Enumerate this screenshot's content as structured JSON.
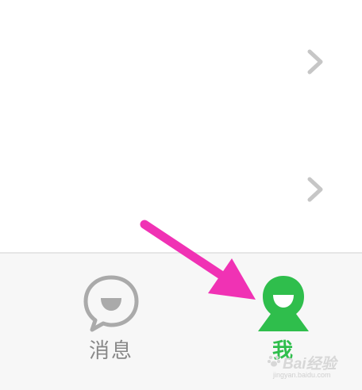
{
  "list": {
    "rows": [
      {
        "chevron_icon": "chevron-right-icon"
      },
      {
        "chevron_icon": "chevron-right-icon"
      }
    ]
  },
  "tabbar": {
    "tabs": [
      {
        "label": "消息",
        "icon": "message-bubble-icon",
        "selected": false
      },
      {
        "label": "我",
        "icon": "profile-person-icon",
        "selected": true
      }
    ]
  },
  "annotation": {
    "arrow_color": "#f032b4",
    "points_to": "tab-me"
  },
  "colors": {
    "accent": "#2fbe4c",
    "inactive": "#888888",
    "tabbar_bg": "#f7f7f7",
    "chevron": "#c6c6c6"
  },
  "watermark": {
    "brand": "Bai经验",
    "url": "jingyan.baidu.com"
  }
}
